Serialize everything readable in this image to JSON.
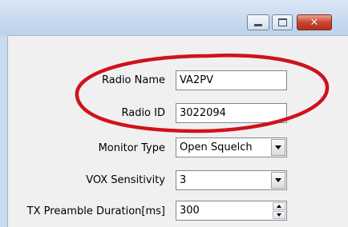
{
  "window": {
    "controls": {
      "minimize_icon": "minimize-icon",
      "maximize_icon": "maximize-icon",
      "close_icon": "close-icon",
      "close_glyph": "✕"
    }
  },
  "form": {
    "radio_name": {
      "label": "Radio Name",
      "value": "VA2PV"
    },
    "radio_id": {
      "label": "Radio ID",
      "value": "3022094"
    },
    "monitor_type": {
      "label": "Monitor Type",
      "value": "Open Squelch"
    },
    "vox_sensitivity": {
      "label": "VOX Sensitivity",
      "value": "3"
    },
    "tx_preamble": {
      "label": "TX Preamble Duration[ms]",
      "value": "300"
    }
  },
  "annotation": {
    "shape": "ellipse",
    "color": "#d0121b"
  },
  "colors": {
    "close_button": "#c9452f",
    "titlebar": "#c7d9ee",
    "annotation": "#d0121b"
  }
}
